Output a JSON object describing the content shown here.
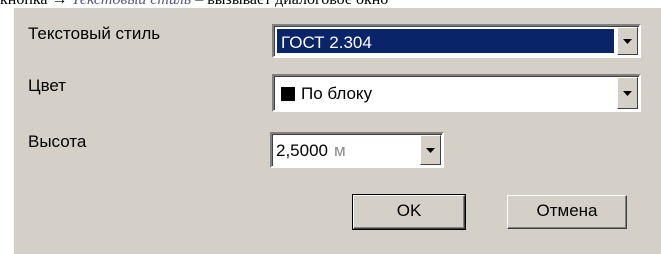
{
  "doc_line": {
    "before": "кнопка",
    "italic": "Текстовый стиль",
    "after": "– вызывает диалоговое окно"
  },
  "fields": {
    "text_style": {
      "label": "Текстовый стиль",
      "value": "ГОСТ 2.304"
    },
    "color": {
      "label": "Цвет",
      "value": "По блоку",
      "swatch_color": "#000000"
    },
    "height": {
      "label": "Высота",
      "value": "2,5000",
      "unit": "м"
    }
  },
  "buttons": {
    "ok": "OK",
    "cancel": "Отмена"
  },
  "icons": {
    "dropdown": "chevron-down-icon"
  },
  "colors": {
    "dialog_bg": "#d4d0c8",
    "selection_bg": "#0a246a"
  }
}
